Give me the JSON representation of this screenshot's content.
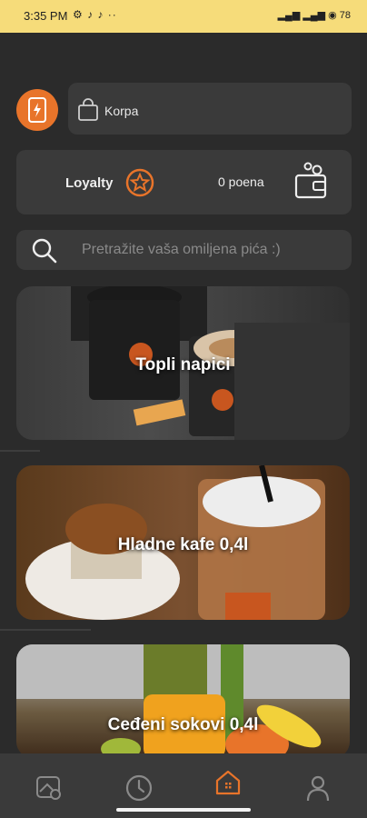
{
  "status": {
    "time": "3:35 PM",
    "notifications": "⚙ ♪ ♪ ··",
    "indicators": "▂▄▆ ▂▄▆ ◉ 78"
  },
  "header": {
    "logo_icon": "bolt-cup-icon",
    "cart_label": "Korpa"
  },
  "loyalty": {
    "title": "Loyalty",
    "points": "0 poena"
  },
  "search": {
    "placeholder": "Pretražite vaša omiljena pića :)"
  },
  "categories": [
    {
      "label": "Topli napici"
    },
    {
      "label": "Hladne kafe 0,4l"
    },
    {
      "label": "Ceđeni sokovi 0,4l"
    }
  ],
  "nav": {
    "items": [
      "map-icon",
      "clock-icon",
      "home-icon",
      "user-icon"
    ],
    "active": "home-icon"
  },
  "colors": {
    "accent": "#e8742a",
    "statusbar": "#f6dc7a",
    "background": "#2b2b2b",
    "panel": "#3a3a3a"
  }
}
